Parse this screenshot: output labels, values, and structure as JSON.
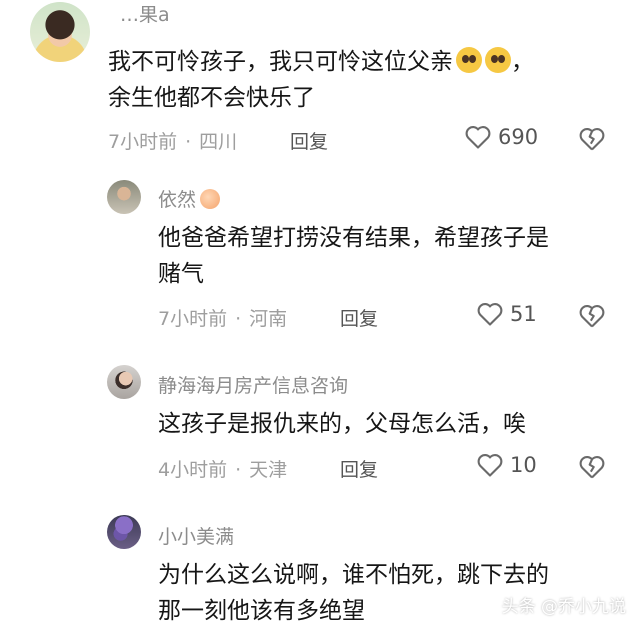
{
  "comments": [
    {
      "username": "…果a",
      "text_lines": [
        "我不可怜孩子，我只可怜这位父亲",
        "余生他都不会快乐了"
      ],
      "trailing_punct": "，",
      "time": "7小时前",
      "location": "四川",
      "reply_label": "回复",
      "likes": "690",
      "emoji": [
        "pleading-face",
        "pleading-face"
      ]
    },
    {
      "username": "依然",
      "text_lines": [
        "他爸爸希望打捞没有结果，希望孩子是",
        "赌气"
      ],
      "time": "7小时前",
      "location": "河南",
      "reply_label": "回复",
      "likes": "51",
      "badge": "peach"
    },
    {
      "username": "静海海月房产信息咨询",
      "text_lines": [
        "这孩子是报仇来的，父母怎么活，唉"
      ],
      "time": "4小时前",
      "location": "天津",
      "reply_label": "回复",
      "likes": "10"
    },
    {
      "username": "小小美满",
      "text_lines": [
        "为什么这么说啊，谁不怕死，跳下去的",
        "那一刻他该有多绝望"
      ]
    }
  ],
  "separator": "·",
  "watermark": "头条 @乔小九说",
  "icons": {
    "like": "heart-outline-icon",
    "dislike": "broken-heart-icon"
  },
  "colors": {
    "meta": "#9e9e9e",
    "text": "#161616",
    "name": "#8c8c8c"
  }
}
